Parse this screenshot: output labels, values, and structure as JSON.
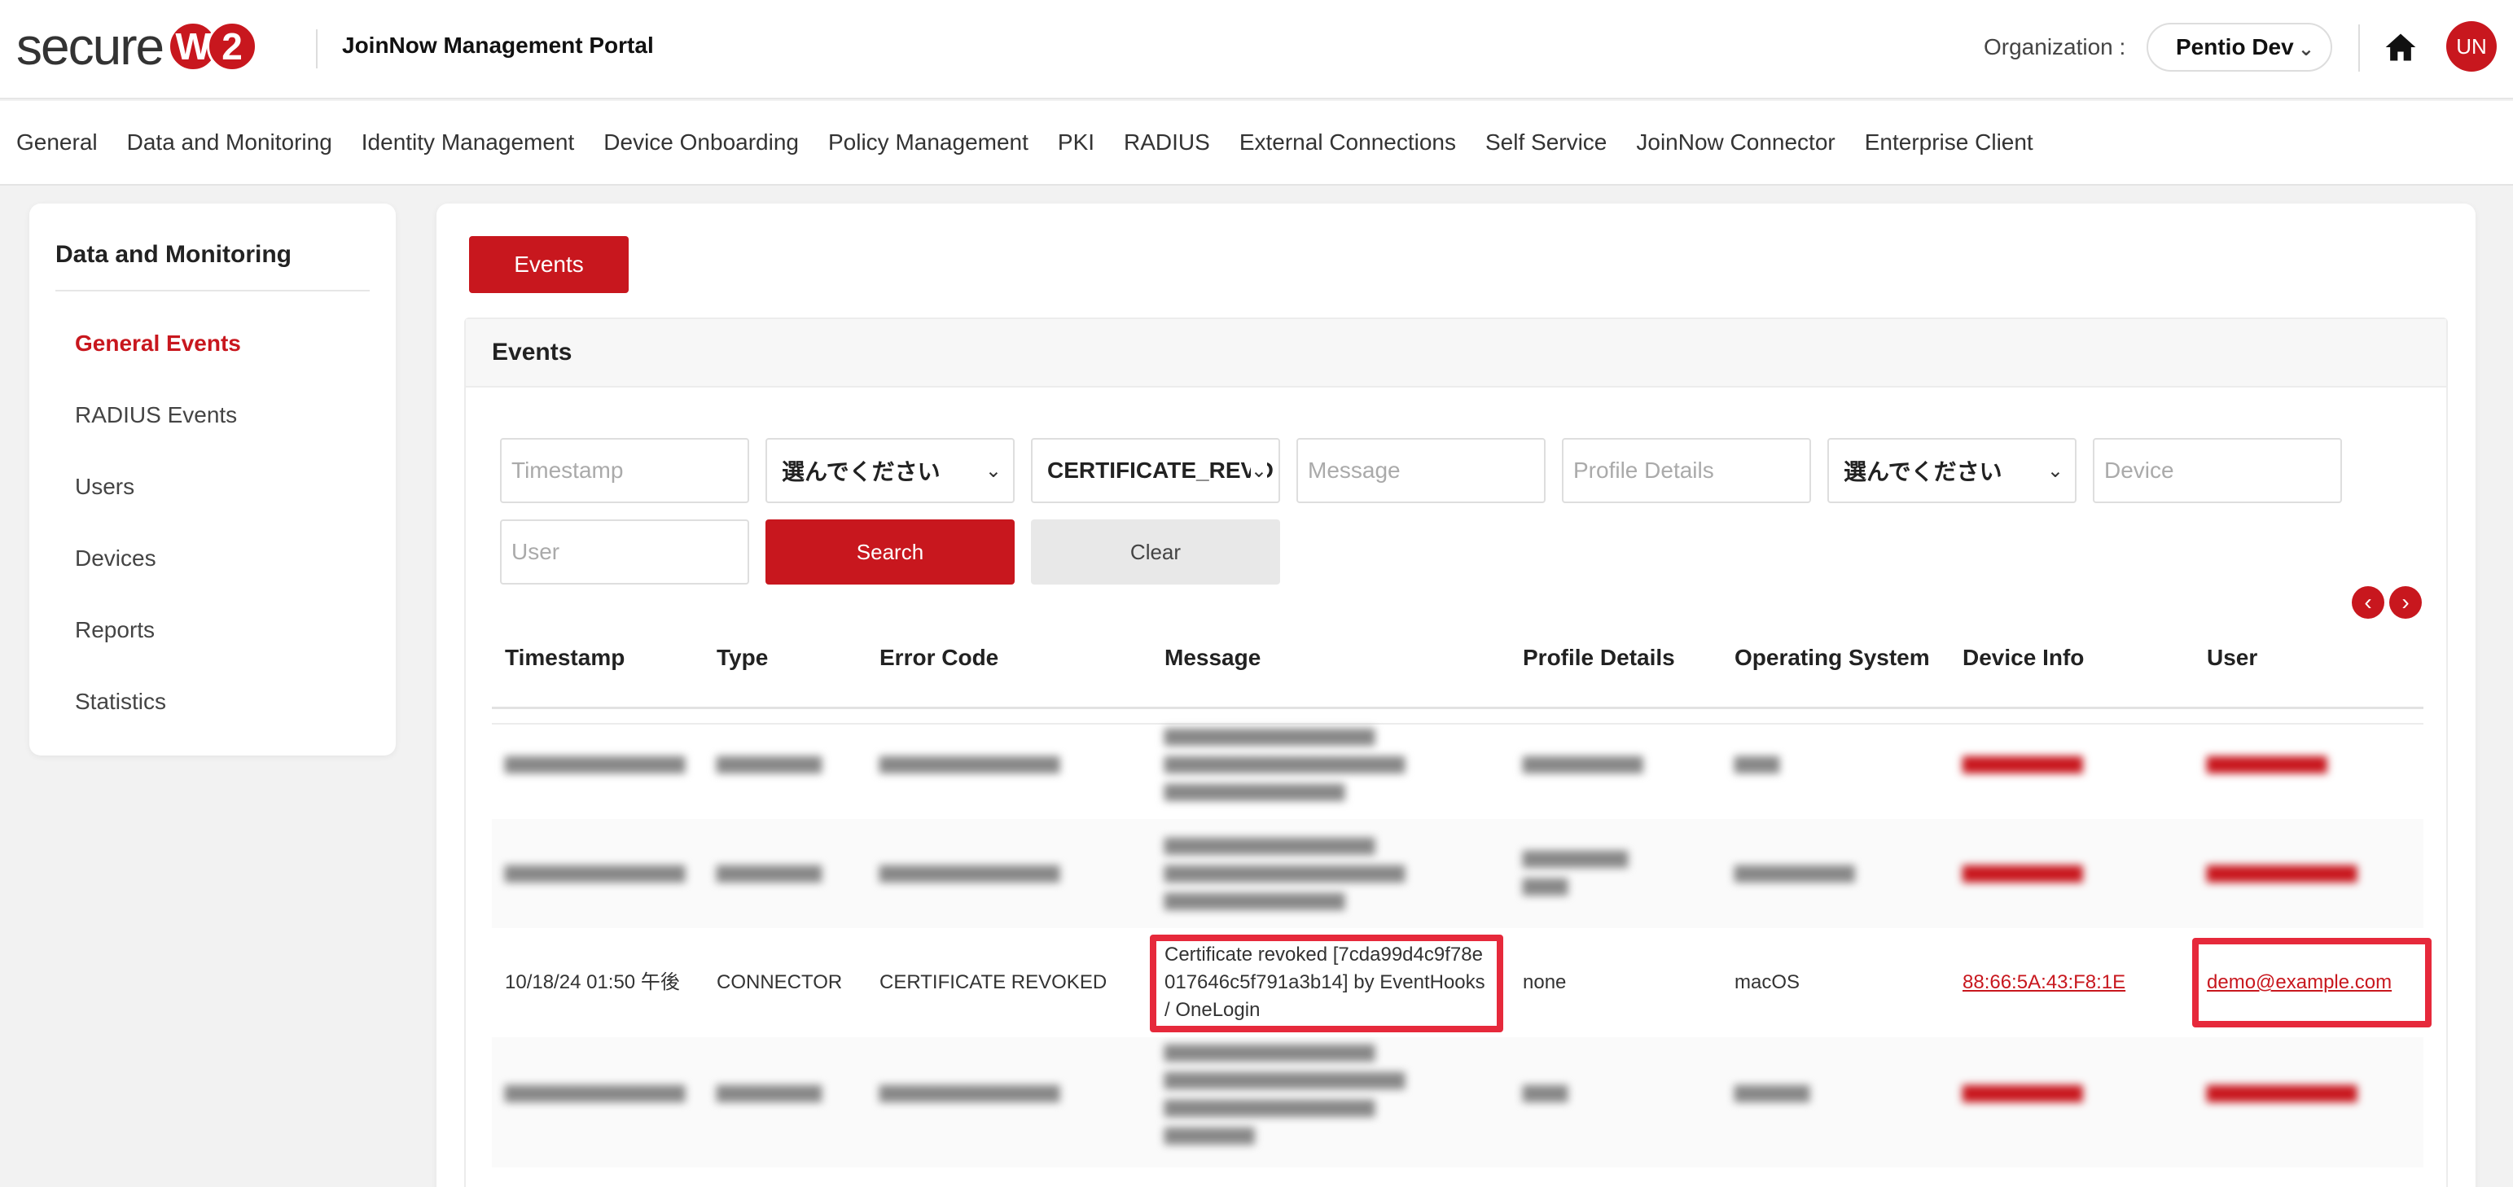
{
  "header": {
    "logo_text": "secure",
    "logo_badge_1": "W",
    "logo_badge_2": "2",
    "portal_title": "JoinNow Management Portal",
    "org_label": "Organization :",
    "org_value": "Pentio Dev",
    "home_icon": "home-icon",
    "avatar_initials": "UN"
  },
  "nav": {
    "items": [
      "General",
      "Data and Monitoring",
      "Identity Management",
      "Device Onboarding",
      "Policy Management",
      "PKI",
      "RADIUS",
      "External Connections",
      "Self Service",
      "JoinNow Connector",
      "Enterprise Client"
    ]
  },
  "sidebar": {
    "title": "Data and Monitoring",
    "items": [
      {
        "label": "General Events",
        "active": true
      },
      {
        "label": "RADIUS Events",
        "active": false
      },
      {
        "label": "Users",
        "active": false
      },
      {
        "label": "Devices",
        "active": false
      },
      {
        "label": "Reports",
        "active": false
      },
      {
        "label": "Statistics",
        "active": false
      }
    ]
  },
  "main": {
    "tab_label": "Events",
    "panel_title": "Events",
    "filters": {
      "timestamp_placeholder": "Timestamp",
      "type_select": "選んでください",
      "error_code_select": "CERTIFICATE_REVO",
      "message_placeholder": "Message",
      "profile_placeholder": "Profile Details",
      "os_select": "選んでください",
      "device_placeholder": "Device",
      "user_placeholder": "User",
      "search_label": "Search",
      "clear_label": "Clear"
    },
    "pager": {
      "prev": "‹",
      "next": "›"
    },
    "table": {
      "columns": [
        "Timestamp",
        "Type",
        "Error Code",
        "Message",
        "Profile Details",
        "Operating System",
        "Device Info",
        "User"
      ],
      "rows": [
        {
          "timestamp": "10/18/24 01:50 午後",
          "type": "CONNECTOR",
          "error_code": "CERTIFICATE REVOKED",
          "message": "Certificate revoked [7cda99d4c9f78e017646c5f791a3b14] by EventHooks / OneLogin",
          "profile": "none",
          "os": "macOS",
          "device": "88:66:5A:43:F8:1E",
          "user": "demo@example.com"
        }
      ]
    }
  },
  "colors": {
    "accent": "#c8171e",
    "highlight": "#e6293b"
  }
}
